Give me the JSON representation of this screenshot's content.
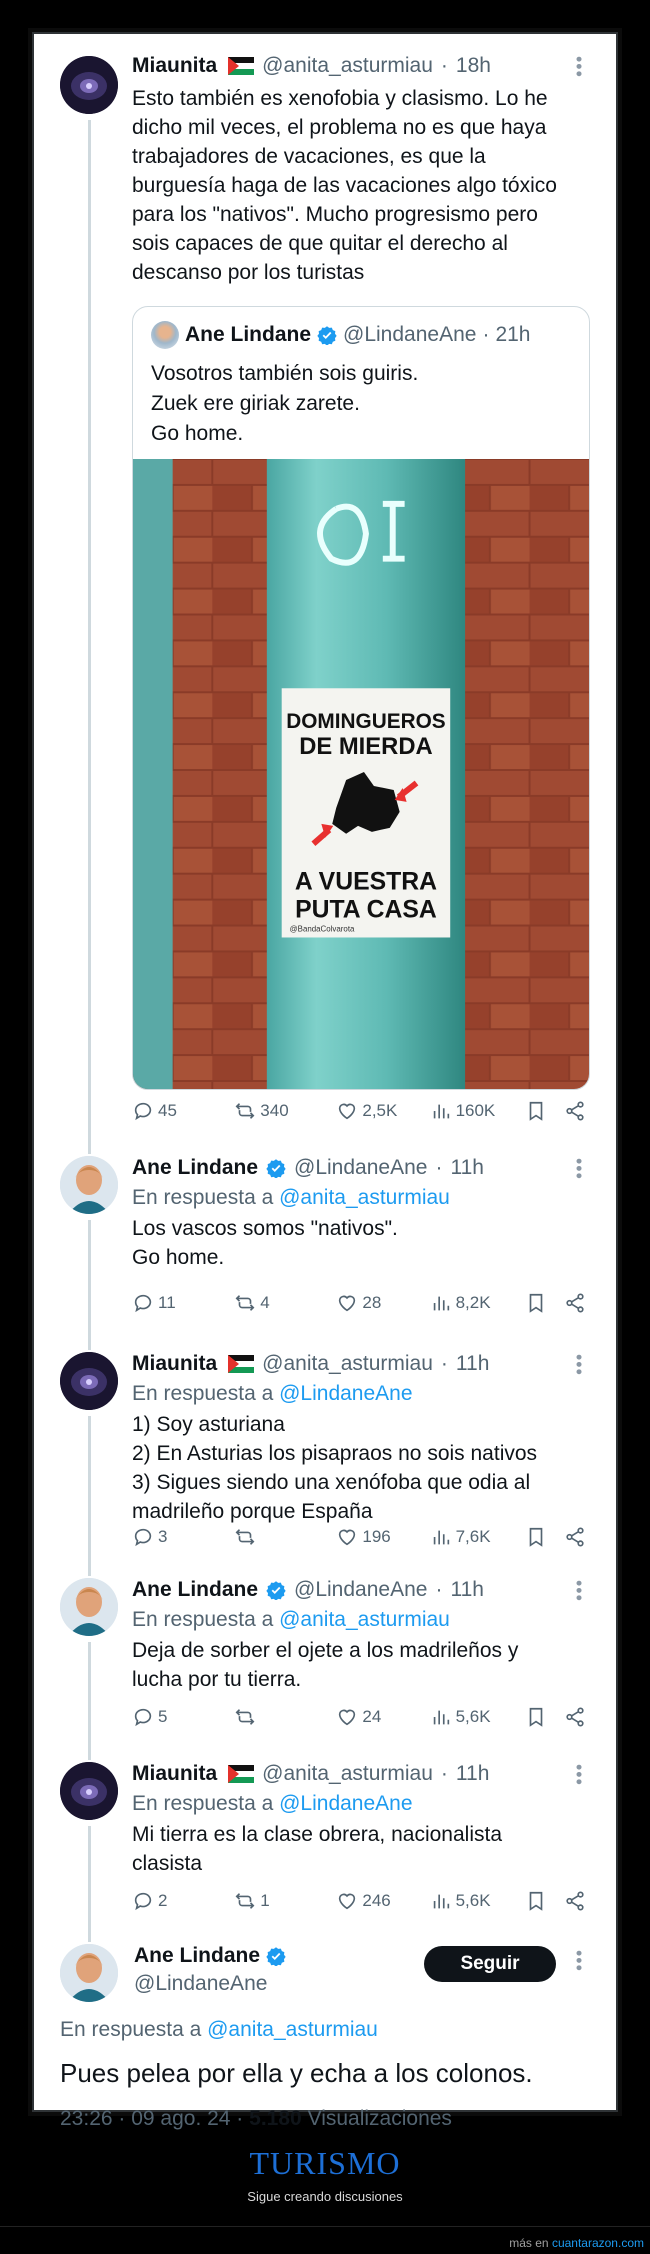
{
  "tweets": [
    {
      "name": "Miaunita",
      "handle": "@anita_asturmiau",
      "time": "18h",
      "text": "Esto también es xenofobia y clasismo. Lo he\ndicho mil veces, el problema no es que haya\ntrabajadores de vacaciones, es que la\nburguesía haga de las vacaciones algo tóxico\npara los \"nativos\". Mucho progresismo pero\nsois capaces de que quitar el derecho al\ndescanso por los turistas",
      "quote": {
        "name": "Ane Lindane",
        "handle": "@LindaneAne",
        "time": "21h",
        "text": "Vosotros también sois guiris.\nZuek ere giriak zarete.\nGo home.",
        "poster": {
          "line1": "DOMINGUEROS",
          "line2": "DE MIERDA",
          "line3": "A VUESTRA",
          "line4": "PUTA CASA",
          "credit": "@BandaColvarota",
          "graffiti": "OI"
        }
      },
      "stats": {
        "replies": "45",
        "retweets": "340",
        "likes": "2,5K",
        "views": "160K"
      }
    },
    {
      "name": "Ane Lindane",
      "handle": "@LindaneAne",
      "time": "11h",
      "reply_prefix": "En respuesta a",
      "reply_to": "@anita_asturmiau",
      "text": "Los vascos somos \"nativos\".\nGo home.",
      "stats": {
        "replies": "11",
        "retweets": "4",
        "likes": "28",
        "views": "8,2K"
      }
    },
    {
      "name": "Miaunita",
      "handle": "@anita_asturmiau",
      "time": "11h",
      "reply_prefix": "En respuesta a",
      "reply_to": "@LindaneAne",
      "text": "1) Soy asturiana\n2) En Asturias los pisapraos no sois nativos\n3) Sigues siendo una xenófoba que odia al\nmadrileño porque España",
      "stats": {
        "replies": "3",
        "retweets": "",
        "likes": "196",
        "views": "7,6K"
      }
    },
    {
      "name": "Ane Lindane",
      "handle": "@LindaneAne",
      "time": "11h",
      "reply_prefix": "En respuesta a",
      "reply_to": "@anita_asturmiau",
      "text": "Deja de sorber el ojete a los madrileños y\nlucha por tu tierra.",
      "stats": {
        "replies": "5",
        "retweets": "",
        "likes": "24",
        "views": "5,6K"
      }
    },
    {
      "name": "Miaunita",
      "handle": "@anita_asturmiau",
      "time": "11h",
      "reply_prefix": "En respuesta a",
      "reply_to": "@LindaneAne",
      "text": "Mi tierra es la clase obrera, nacionalista\nclasista",
      "stats": {
        "replies": "2",
        "retweets": "1",
        "likes": "246",
        "views": "5,6K"
      }
    }
  ],
  "main": {
    "name": "Ane Lindane",
    "handle": "@LindaneAne",
    "follow_label": "Seguir",
    "reply_prefix": "En respuesta a",
    "reply_to": "@anita_asturmiau",
    "text": "Pues pelea por ella y echa a los colonos.",
    "time": "23:26 · 09 ago. 24 ·",
    "views_count": "5.180",
    "views_label": "Visualizaciones"
  },
  "caption": {
    "title": "TURISMO",
    "subtitle": "Sigue creando discusiones"
  },
  "footer": {
    "prefix": "más en",
    "site": "cuantarazon.com"
  },
  "colors": {
    "link": "#1d9bf0",
    "verified": "#1d9bf0",
    "caption_title": "#1d6fd6"
  }
}
